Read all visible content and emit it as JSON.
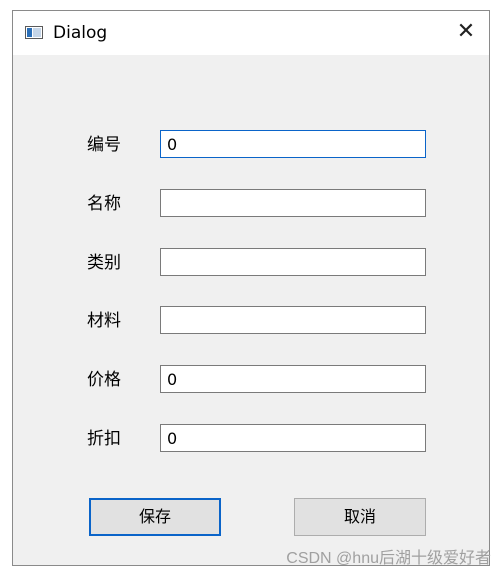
{
  "window": {
    "title": "Dialog",
    "close_glyph": "✕",
    "app_icon": "window-app-icon"
  },
  "form": {
    "fields": [
      {
        "label": "编号",
        "value": "0"
      },
      {
        "label": "名称",
        "value": ""
      },
      {
        "label": "类别",
        "value": ""
      },
      {
        "label": "材料",
        "value": ""
      },
      {
        "label": "价格",
        "value": "0"
      },
      {
        "label": "折扣",
        "value": "0"
      }
    ]
  },
  "buttons": {
    "save": "保存",
    "cancel": "取消"
  },
  "watermark": "CSDN @hnu后湖十级爱好者",
  "colors": {
    "accent": "#0a64c9",
    "dialog_bg": "#f0f0f0",
    "button_bg": "#e1e1e1"
  }
}
